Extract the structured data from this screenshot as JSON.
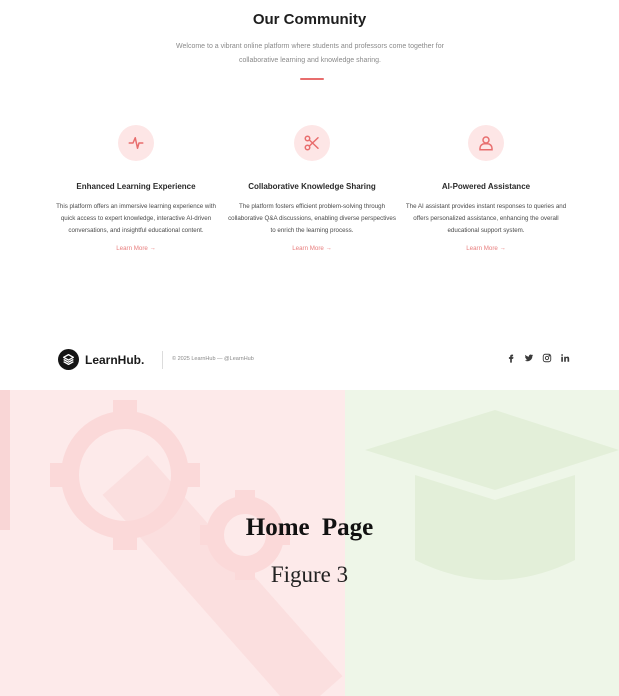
{
  "community": {
    "title": "Our Community",
    "intro_line1": "Welcome to a vibrant online platform where students and professors come together for",
    "intro_line2": "collaborative learning and knowledge sharing."
  },
  "features": [
    {
      "icon": "pulse-icon",
      "title": "Enhanced Learning Experience",
      "description": "This platform offers an immersive learning experience with quick access to expert knowledge, interactive AI-driven conversations, and insightful educational content.",
      "link": "Learn More →"
    },
    {
      "icon": "scissors-icon",
      "title": "Collaborative Knowledge Sharing",
      "description": "The platform fosters efficient problem-solving through collaborative Q&A discussions, enabling diverse perspectives to enrich the learning process.",
      "link": "Learn More →"
    },
    {
      "icon": "user-icon",
      "title": "AI-Powered Assistance",
      "description": "The AI assistant provides instant responses to queries and offers personalized assistance, enhancing the overall educational support system.",
      "link": "Learn More →"
    }
  ],
  "footer": {
    "brand": "LearnHub.",
    "copyright": "© 2025 LearnHub — @LearnHub",
    "socials": [
      "facebook-icon",
      "twitter-icon",
      "instagram-icon",
      "linkedin-icon"
    ]
  },
  "caption": {
    "main": "Home Page",
    "sub": "Figure 3"
  },
  "colors": {
    "accent": "#e86d6d",
    "icon_bg": "#fde6e6",
    "panel_red": "#fdeaea",
    "panel_green": "#eef6e8"
  }
}
